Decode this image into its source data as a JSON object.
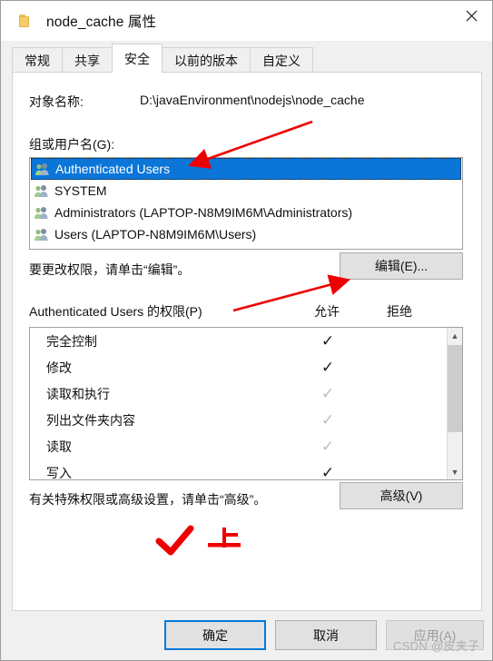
{
  "window": {
    "title": "node_cache 属性",
    "folder_icon": "folder-icon",
    "close_icon": "close-icon"
  },
  "tabs": [
    {
      "label": "常规",
      "active": false
    },
    {
      "label": "共享",
      "active": false
    },
    {
      "label": "安全",
      "active": true
    },
    {
      "label": "以前的版本",
      "active": false
    },
    {
      "label": "自定义",
      "active": false
    }
  ],
  "security": {
    "object_label": "对象名称:",
    "object_path": "D:\\javaEnvironment\\nodejs\\node_cache",
    "group_label": "组或用户名(G):",
    "groups": [
      {
        "name": "Authenticated Users",
        "selected": true
      },
      {
        "name": "SYSTEM",
        "selected": false
      },
      {
        "name": "Administrators (LAPTOP-N8M9IM6M\\Administrators)",
        "selected": false
      },
      {
        "name": "Users (LAPTOP-N8M9IM6M\\Users)",
        "selected": false
      }
    ],
    "edit_hint": "要更改权限，请单击“编辑”。",
    "edit_button": "编辑(E)...",
    "permissions_title": "Authenticated Users 的权限(P)",
    "col_allow": "允许",
    "col_deny": "拒绝",
    "permissions": [
      {
        "name": "完全控制",
        "allow": "check-dark",
        "deny": ""
      },
      {
        "name": "修改",
        "allow": "check-dark",
        "deny": ""
      },
      {
        "name": "读取和执行",
        "allow": "check-gray",
        "deny": ""
      },
      {
        "name": "列出文件夹内容",
        "allow": "check-gray",
        "deny": ""
      },
      {
        "name": "读取",
        "allow": "check-gray",
        "deny": ""
      },
      {
        "name": "写入",
        "allow": "check-dark",
        "deny": ""
      }
    ],
    "advanced_hint": "有关特殊权限或高级设置，请单击“高级”。",
    "advanced_button": "高级(V)"
  },
  "footer": {
    "ok": "确定",
    "cancel": "取消",
    "apply": "应用(A)",
    "apply_disabled": true
  },
  "annotations": {
    "arrow_to_selected_user": "red-arrow-icon",
    "arrow_to_edit_button": "red-arrow-icon",
    "red_check": "red-check-icon",
    "red_text": "上"
  },
  "watermark": "CSDN @皮夹子",
  "colors": {
    "selection_blue": "#0b76d8",
    "focus_blue": "#0078d7",
    "annotation_red": "#ee0000",
    "dialog_bg": "#f0f0f0",
    "button_bg": "#e1e1e1"
  }
}
